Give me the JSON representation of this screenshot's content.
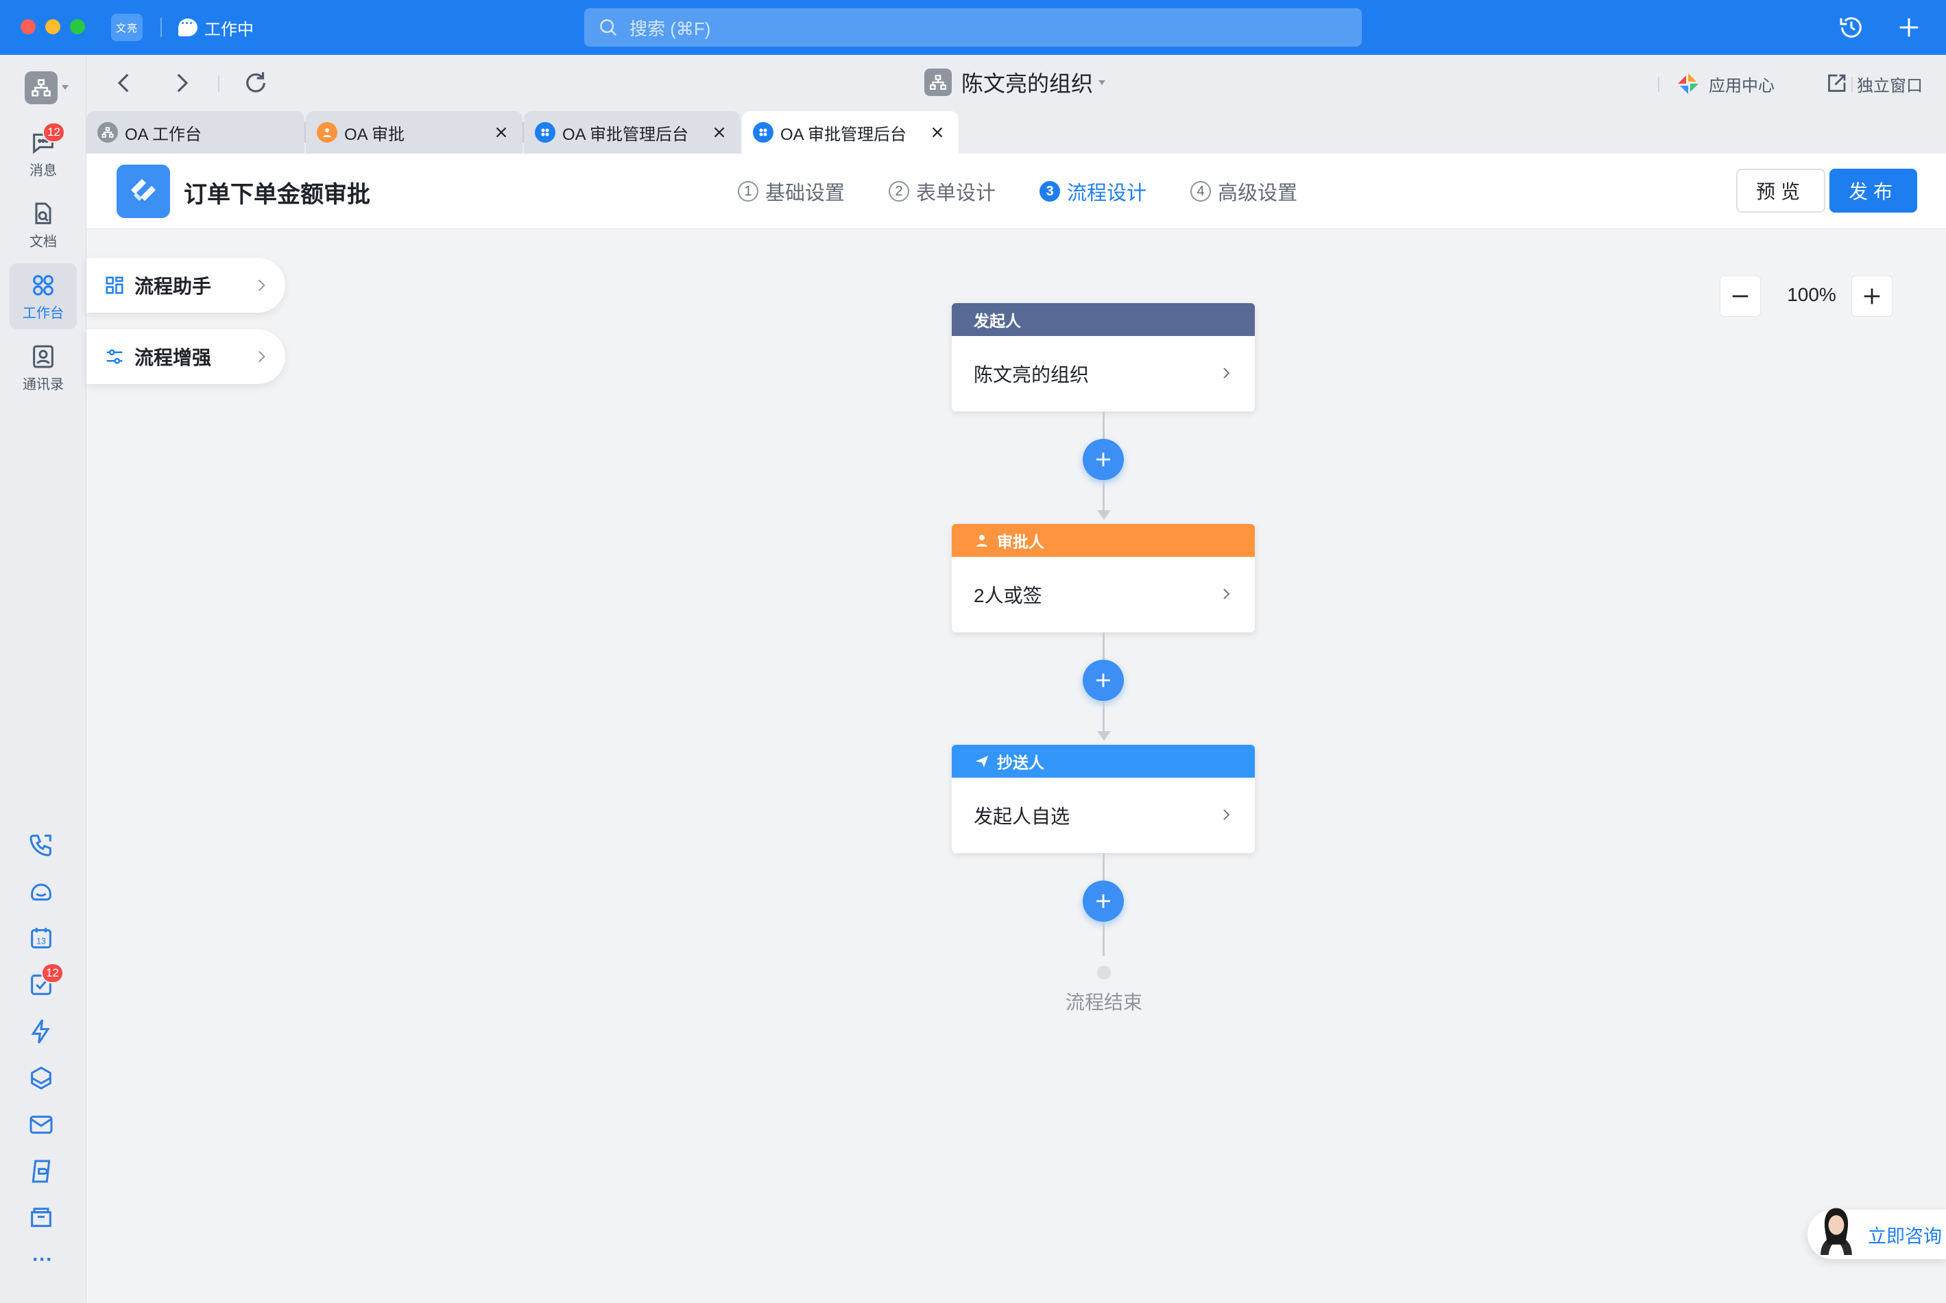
{
  "titlebar": {
    "brand": "文亮",
    "status": "工作中",
    "search_placeholder": "搜索 (⌘F)"
  },
  "sidebar": {
    "items": [
      {
        "label": "消息",
        "icon": "message-icon",
        "badge": "12"
      },
      {
        "label": "文档",
        "icon": "document-icon"
      },
      {
        "label": "工作台",
        "icon": "workbench-icon",
        "active": true
      },
      {
        "label": "通讯录",
        "icon": "contacts-icon"
      }
    ],
    "tools": [
      "phone-icon",
      "cloud-icon",
      "calendar-icon",
      "todo-icon",
      "lightning-icon",
      "box-icon",
      "mail-icon",
      "drive-icon",
      "folder-icon",
      "more-icon"
    ],
    "calendar_day": "13",
    "todo_badge": "12",
    "more": "···"
  },
  "navrow": {
    "org_name": "陈文亮的组织",
    "app_center": "应用中心",
    "standalone": "独立窗口"
  },
  "tabs": [
    {
      "label": "OA 工作台",
      "icon": "org-icon",
      "closable": false
    },
    {
      "label": "OA 审批",
      "icon": "user-icon",
      "closable": true
    },
    {
      "label": "OA 审批管理后台",
      "icon": "grid-icon",
      "closable": true
    },
    {
      "label": "OA 审批管理后台",
      "icon": "grid-icon",
      "closable": true,
      "active": true
    }
  ],
  "header": {
    "title": "订单下单金额审批",
    "steps": [
      {
        "num": "1",
        "label": "基础设置"
      },
      {
        "num": "2",
        "label": "表单设计"
      },
      {
        "num": "3",
        "label": "流程设计",
        "active": true
      },
      {
        "num": "4",
        "label": "高级设置"
      }
    ],
    "preview": "预览",
    "publish": "发布"
  },
  "panel": {
    "assistant": "流程助手",
    "enhance": "流程增强"
  },
  "zoom": {
    "value": "100%"
  },
  "flow": {
    "nodes": [
      {
        "header": "发起人",
        "body": "陈文亮的组织",
        "color": "#576a95"
      },
      {
        "header": "审批人",
        "body": "2人或签",
        "color": "#ff943e"
      },
      {
        "header": "抄送人",
        "body": "发起人自选",
        "color": "#3296fa"
      }
    ],
    "end_label": "流程结束"
  },
  "consult": {
    "label": "立即咨询"
  },
  "colors": {
    "accent": "#1e7ef0",
    "initiator": "#576a95",
    "approver": "#ff943e",
    "cc": "#3296fa",
    "badge": "#f54a45"
  }
}
